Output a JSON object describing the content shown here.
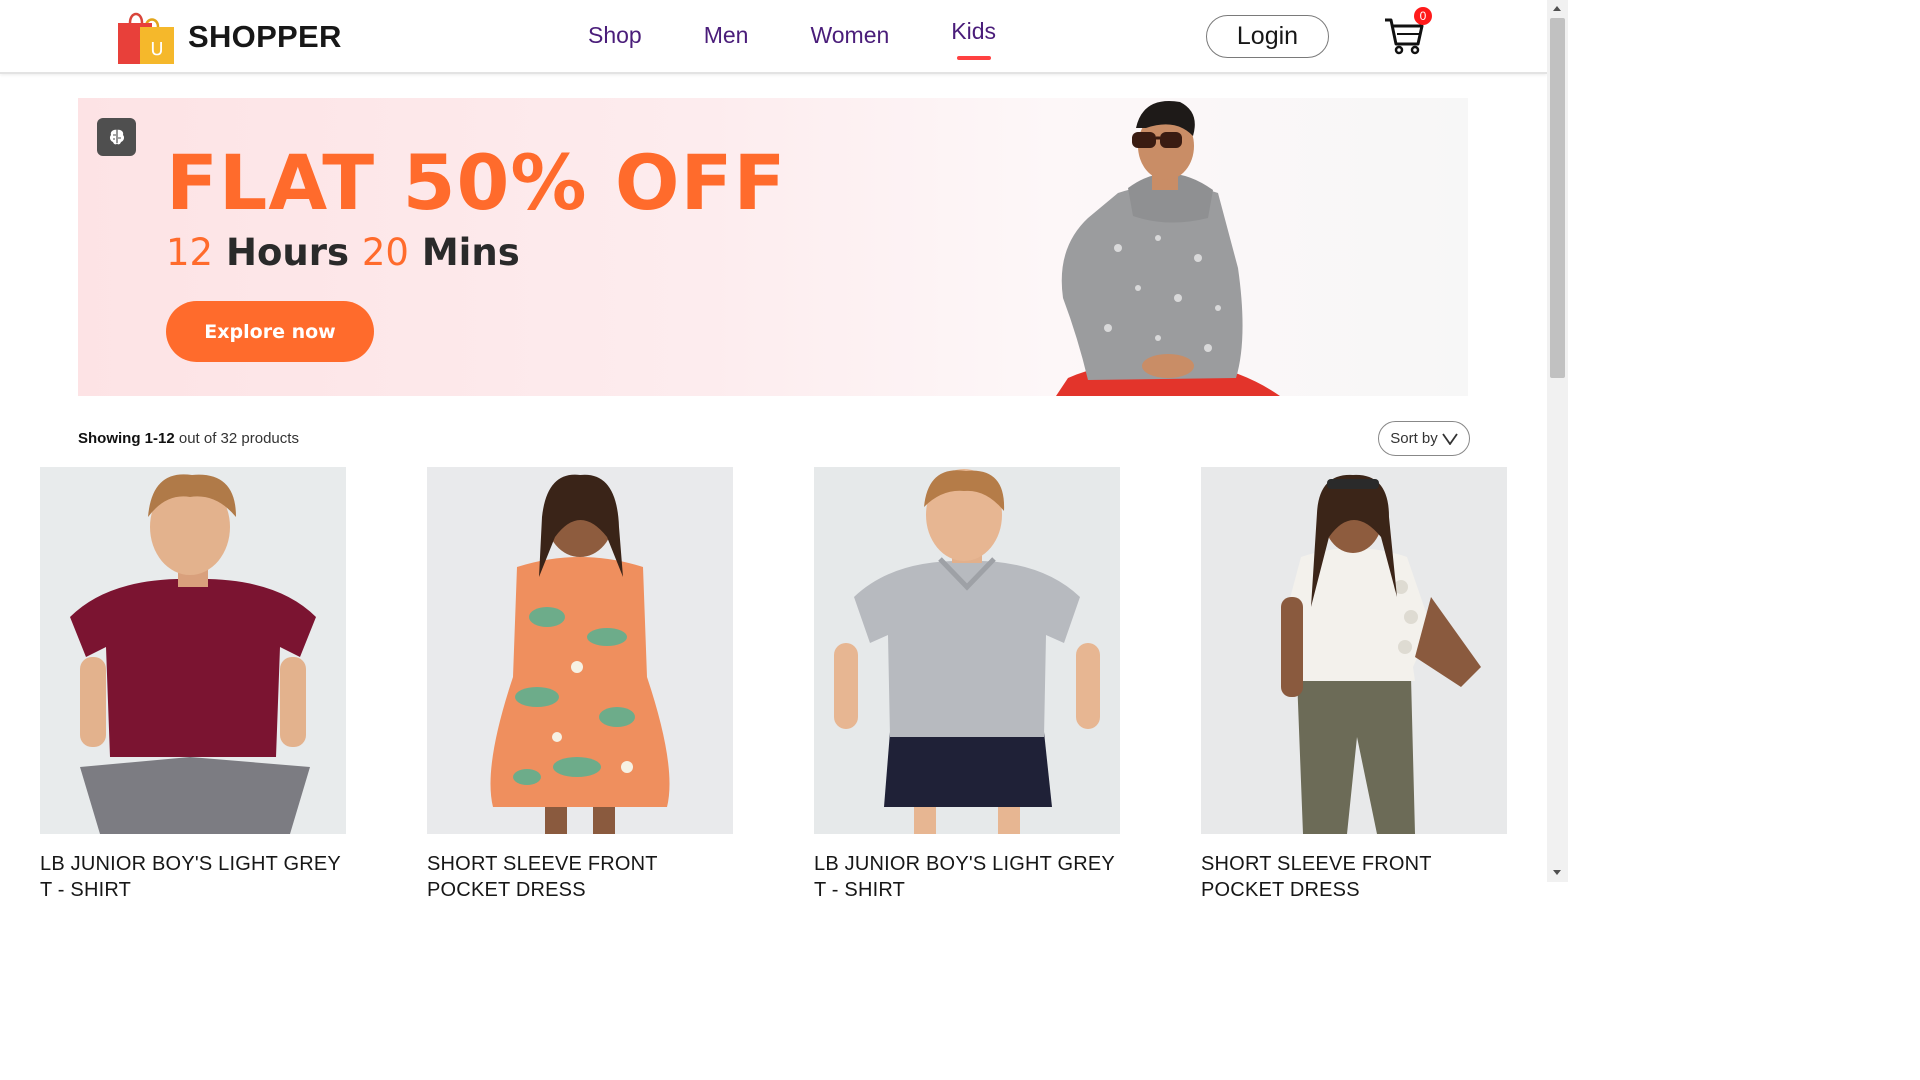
{
  "brand": {
    "name": "SHOPPER",
    "logo_letter": "U"
  },
  "nav": {
    "items": [
      {
        "label": "Shop",
        "active": false
      },
      {
        "label": "Men",
        "active": false
      },
      {
        "label": "Women",
        "active": false
      },
      {
        "label": "Kids",
        "active": true
      }
    ]
  },
  "header": {
    "login_label": "Login",
    "cart_count": "0"
  },
  "banner": {
    "title": "FLAT 50% OFF",
    "hours_num": "12",
    "hours_label": "Hours",
    "mins_num": "20",
    "mins_label": "Mins",
    "cta": "Explore now"
  },
  "toolbar": {
    "showing_range": "Showing 1-12",
    "showing_rest": "out of 32 products",
    "sort_label": "Sort by"
  },
  "products": [
    {
      "name": "LB JUNIOR BOY'S LIGHT GREY T - SHIRT"
    },
    {
      "name": "SHORT SLEEVE FRONT POCKET DRESS"
    },
    {
      "name": "LB JUNIOR BOY'S LIGHT GREY T - SHIRT"
    },
    {
      "name": "SHORT SLEEVE FRONT POCKET DRESS"
    }
  ],
  "colors": {
    "accent": "#ff6b2c",
    "nav": "#4a1d7a",
    "active_underline": "#ff4141",
    "badge": "#ff1a1a"
  }
}
